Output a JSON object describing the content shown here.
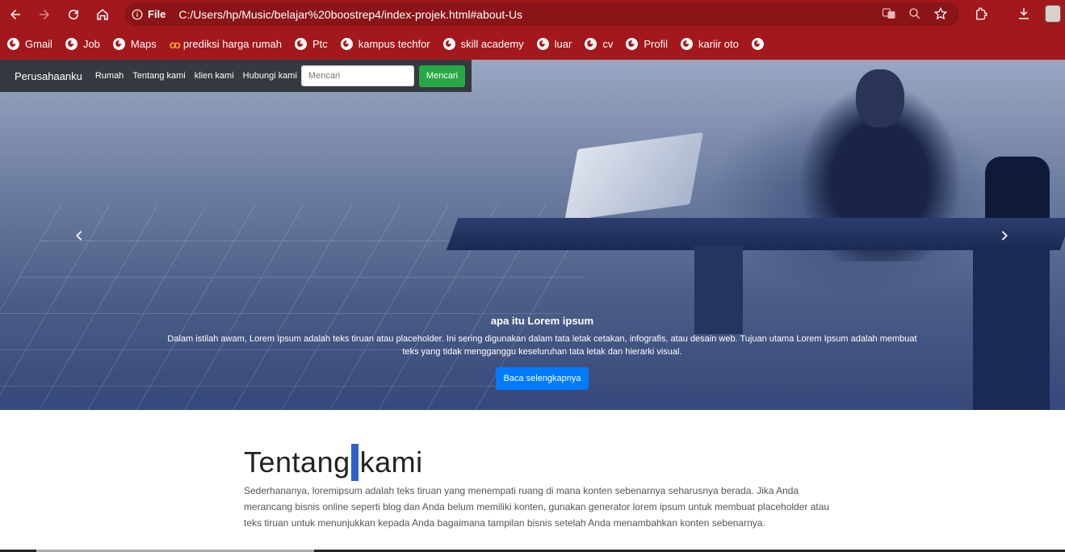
{
  "browser": {
    "file_label": "File",
    "url": "C:/Users/hp/Music/belajar%20boostrep4/index-projek.html#about-Us",
    "bookmarks": [
      {
        "label": "Gmail",
        "icon": "globe-icon"
      },
      {
        "label": "Job",
        "icon": "globe-icon"
      },
      {
        "label": "Maps",
        "icon": "globe-icon"
      },
      {
        "label": "prediksi harga rumah",
        "icon": "infinity-icon"
      },
      {
        "label": "Ptc",
        "icon": "globe-icon"
      },
      {
        "label": "kampus techfor",
        "icon": "globe-icon"
      },
      {
        "label": "skill academy",
        "icon": "globe-icon"
      },
      {
        "label": "luar",
        "icon": "globe-icon"
      },
      {
        "label": "cv",
        "icon": "globe-icon"
      },
      {
        "label": "Profil",
        "icon": "globe-icon"
      },
      {
        "label": "kariir oto",
        "icon": "globe-icon"
      }
    ],
    "accent_color": "#a3181c"
  },
  "navbar": {
    "brand": "Perusahaanku",
    "links": [
      "Rumah",
      "Tentang kami",
      "klien kami",
      "Hubungi kami"
    ],
    "search_placeholder": "Mencari",
    "search_button": "Mencari"
  },
  "hero": {
    "caption_title": "apa itu Lorem ipsum",
    "caption_text": "Dalam istilah awam, Lorem Ipsum adalah teks tiruan atau placeholder. Ini sering digunakan dalam tata letak cetakan, infografis, atau desain web. Tujuan utama Lorem Ipsum adalah membuat teks yang tidak mengganggu keseluruhan tata letak dan hierarki visual.",
    "button_label": "Baca selengkapnya"
  },
  "about": {
    "title_part1": "Tentang",
    "title_part2": "kami",
    "text": "Sederhananya, loremipsum adalah teks tiruan yang menempati ruang di mana konten sebenarnya seharusnya berada. Jika Anda merancang bisnis online seperti blog dan Anda belum memiliki konten, gunakan generator lorem ipsum untuk membuat placeholder atau teks tiruan untuk menunjukkan kepada Anda bagaimana tampilan bisnis setelah Anda menambahkan konten sebenarnya."
  }
}
